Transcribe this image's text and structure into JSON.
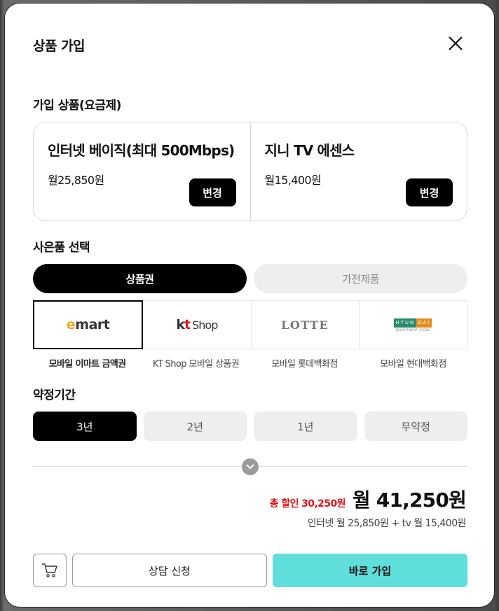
{
  "modal": {
    "title": "상품 가입"
  },
  "products_section": {
    "title": "가입 상품(요금제)",
    "items": [
      {
        "name": "인터넷 베이직(최대 500Mbps)",
        "price": "월25,850원",
        "change_label": "변경"
      },
      {
        "name": "지니 TV 에센스",
        "price": "월15,400원",
        "change_label": "변경"
      }
    ]
  },
  "gift_section": {
    "title": "사은품 선택",
    "tabs": [
      {
        "label": "상품권",
        "active": true
      },
      {
        "label": "가전제품",
        "active": false
      }
    ],
    "brands": [
      {
        "logo_e": "e",
        "logo_rest": "mart",
        "caption": "모바일 이마트 금액권",
        "selected": true
      },
      {
        "logo_k": "k",
        "logo_t": "t",
        "logo_shop": "Shop",
        "caption": "KT Shop 모바일 상품권",
        "selected": false
      },
      {
        "logo": "LOTTE",
        "caption": "모바일 롯데백화점",
        "selected": false
      },
      {
        "logo_a": "HYUN",
        "logo_b": "DAI",
        "logo_sub": "DEPARTMENT STORE",
        "caption": "모바일 현대백화점",
        "selected": false
      }
    ]
  },
  "term_section": {
    "title": "약정기간",
    "options": [
      {
        "label": "3년",
        "active": true
      },
      {
        "label": "2년",
        "active": false
      },
      {
        "label": "1년",
        "active": false
      },
      {
        "label": "무약정",
        "active": false
      }
    ]
  },
  "summary": {
    "discount": "총 할인 30,250원",
    "total": "월 41,250원",
    "breakdown": "인터넷 월 25,850원 + tv 월 15,400원"
  },
  "actions": {
    "consult_label": "상담 신청",
    "join_label": "바로 가입"
  },
  "colors": {
    "accent": "#5fdedb",
    "discount": "#e0161a",
    "primary": "#000000"
  }
}
